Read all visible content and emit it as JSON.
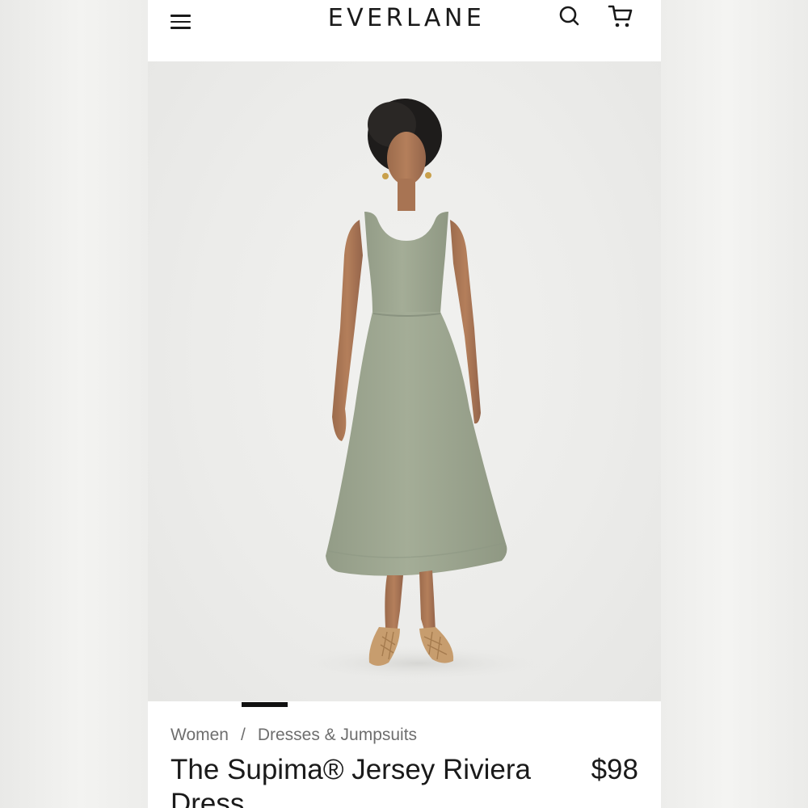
{
  "header": {
    "brand": "EVERLANE",
    "menu_icon": "hamburger-menu-icon",
    "search_icon": "search-icon",
    "cart_icon": "cart-icon"
  },
  "gallery": {
    "current_slide": 1,
    "dress_color": "#9fa892"
  },
  "breadcrumb": {
    "items": [
      "Women",
      "Dresses & Jumpsuits"
    ],
    "separator": "/"
  },
  "product": {
    "title": "The Supima® Jersey Riviera Dress",
    "price": "$98"
  }
}
